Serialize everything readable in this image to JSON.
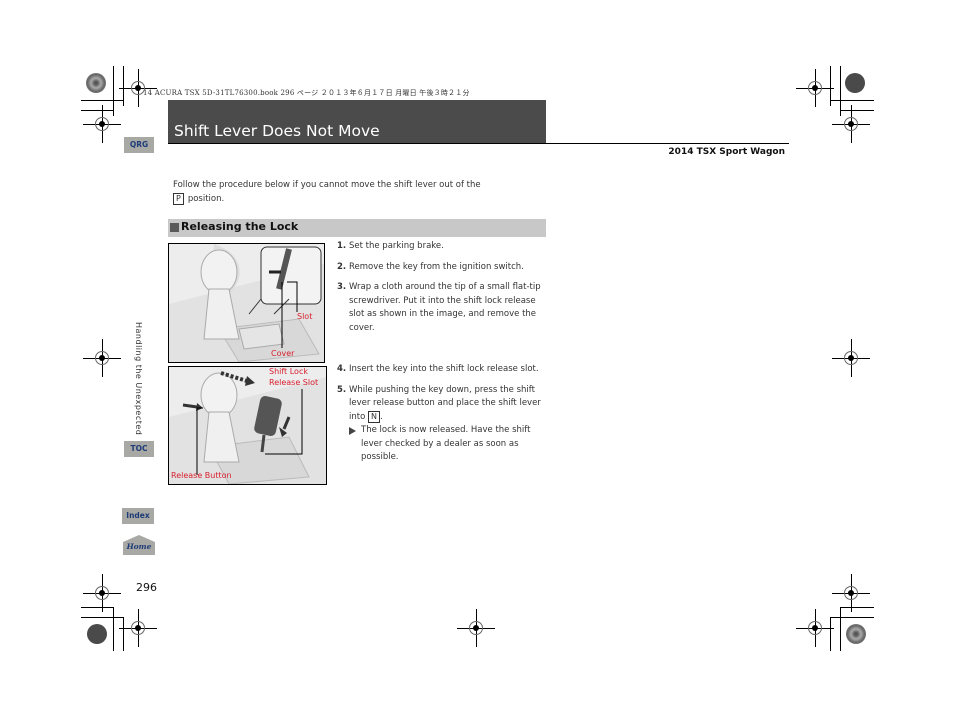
{
  "print_header": "14 ACURA TSX 5D-31TL76300.book  296 ページ  ２０１３年６月１７日  月曜日  午後３時２１分",
  "title": "Shift Lever Does Not Move",
  "model": "2014 TSX Sport Wagon",
  "nav": {
    "qrg": "QRG",
    "toc": "TOC",
    "index": "Index",
    "home": "Home",
    "section": "Handling the Unexpected"
  },
  "intro": {
    "text": "Follow the procedure below if you cannot move the shift lever out of the",
    "key": "P",
    "suffix": "position."
  },
  "section_title": "Releasing the Lock",
  "figure1": {
    "labels": {
      "slot": "Slot",
      "cover": "Cover"
    }
  },
  "figure2": {
    "labels": {
      "shift_lock_line1": "Shift Lock",
      "shift_lock_line2": "Release Slot",
      "release_button": "Release Button"
    }
  },
  "steps_a": [
    {
      "num": "1.",
      "text": "Set the parking brake."
    },
    {
      "num": "2.",
      "text": "Remove the key from the ignition switch."
    },
    {
      "num": "3.",
      "text": "Wrap a cloth around the tip of a small flat-tip screwdriver. Put it into the shift lock release slot as shown in the image, and remove the cover."
    }
  ],
  "steps_b": [
    {
      "num": "4.",
      "text": "Insert the key into the shift lock release slot."
    },
    {
      "num": "5.",
      "text_before": "While pushing the key down, press the shift lever release button and place the shift lever into",
      "key": "N",
      "text_after": "."
    }
  ],
  "note": "The lock is now released. Have the shift lever checked by a dealer as soon as possible.",
  "page_number": "296",
  "colors": {
    "title_bar": "#4b4b4b",
    "section_bar": "#c8c8c8",
    "nav_tab": "#a8a8a4",
    "nav_text": "#1e3c78",
    "callout_red": "#d81e2c"
  }
}
